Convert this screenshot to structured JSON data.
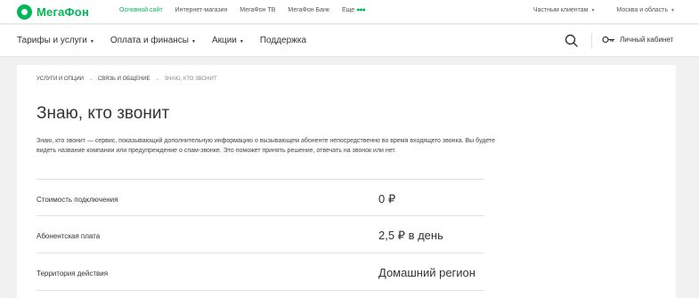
{
  "brand": {
    "name": "МегаФон",
    "color": "#00b956"
  },
  "top_links": [
    {
      "label": "Основной сайт",
      "active": true
    },
    {
      "label": "Интернет-магазин",
      "active": false
    },
    {
      "label": "МегаФон ТВ",
      "active": false
    },
    {
      "label": "МегаФон Банк",
      "active": false
    },
    {
      "label": "Еще",
      "active": false
    }
  ],
  "top_right": {
    "clients": "Частным клиентам",
    "region": "Москва и область"
  },
  "nav": {
    "items": [
      {
        "label": "Тарифы и услуги"
      },
      {
        "label": "Оплата и финансы"
      },
      {
        "label": "Акции"
      },
      {
        "label": "Поддержка"
      }
    ],
    "cabinet": "Личный кабинет"
  },
  "breadcrumb": {
    "items": [
      "Услуги и опции",
      "Связь и общение",
      "Знаю, кто звонит"
    ]
  },
  "page": {
    "title": "Знаю, кто звонит",
    "description": "Знаю, кто звонит — сервис, показывающий дополнительную информацию о вызывающем абоненте непосредственно во время входящего звонка. Вы будете видеть название компании или предупреждение о спам-звонке. Это поможет принять решение, отвечать на звонок или нет."
  },
  "params": [
    {
      "label": "Стоимость подключения",
      "value": "0 ₽"
    },
    {
      "label": "Абонентская плата",
      "value": "2,5 ₽ в день"
    },
    {
      "label": "Территория действия",
      "value": "Домашний регион"
    }
  ]
}
